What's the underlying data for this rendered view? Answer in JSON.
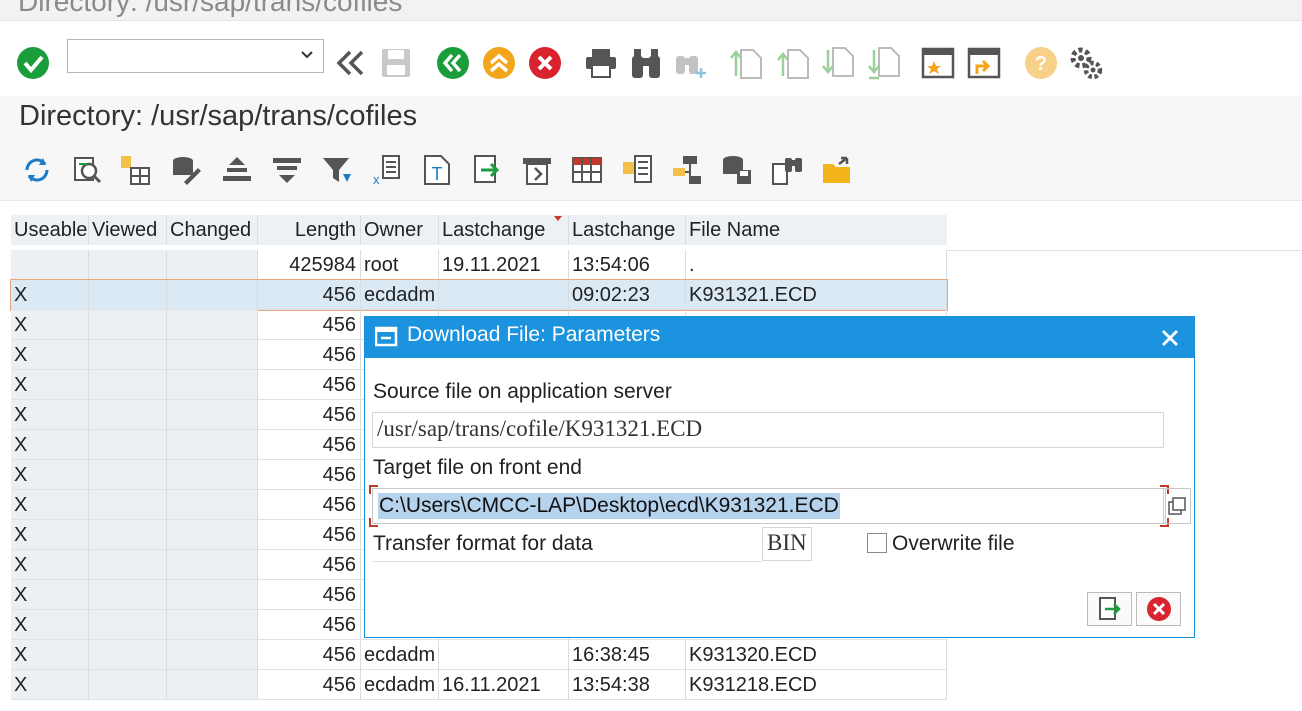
{
  "window": {
    "title": "Directory: /usr/sap/trans/cofiles"
  },
  "command_field": {
    "value": "",
    "placeholder": ""
  },
  "page": {
    "title": "Directory: /usr/sap/trans/cofiles"
  },
  "colors": {
    "accent": "#1c93de",
    "ok_green": "#1a9e3b",
    "cancel_red": "#d9232e",
    "warn_orange": "#f3a51c",
    "selection": "#dbe9f5",
    "header_bg": "#eef1f4"
  },
  "table": {
    "columns": [
      "Useable",
      "Viewed",
      "Changed",
      "Length",
      "Owner",
      "Lastchange",
      "Lastchange",
      "File Name"
    ],
    "rows": [
      {
        "useable": "",
        "viewed": "",
        "changed": "",
        "length": "425984",
        "owner": "root",
        "date": "19.11.2021",
        "time": "13:54:06",
        "file": "."
      },
      {
        "useable": "X",
        "viewed": "",
        "changed": "",
        "length": "456",
        "owner": "ecdadm",
        "date": "",
        "time": "09:02:23",
        "file": "K931321.ECD"
      },
      {
        "useable": "X",
        "viewed": "",
        "changed": "",
        "length": "456",
        "owner": "",
        "date": "",
        "time": "",
        "file": ""
      },
      {
        "useable": "X",
        "viewed": "",
        "changed": "",
        "length": "456",
        "owner": "",
        "date": "",
        "time": "",
        "file": ""
      },
      {
        "useable": "X",
        "viewed": "",
        "changed": "",
        "length": "456",
        "owner": "",
        "date": "",
        "time": "",
        "file": ""
      },
      {
        "useable": "X",
        "viewed": "",
        "changed": "",
        "length": "456",
        "owner": "",
        "date": "",
        "time": "",
        "file": ""
      },
      {
        "useable": "X",
        "viewed": "",
        "changed": "",
        "length": "456",
        "owner": "",
        "date": "",
        "time": "",
        "file": ""
      },
      {
        "useable": "X",
        "viewed": "",
        "changed": "",
        "length": "456",
        "owner": "",
        "date": "",
        "time": "",
        "file": ""
      },
      {
        "useable": "X",
        "viewed": "",
        "changed": "",
        "length": "456",
        "owner": "",
        "date": "",
        "time": "",
        "file": ""
      },
      {
        "useable": "X",
        "viewed": "",
        "changed": "",
        "length": "456",
        "owner": "",
        "date": "",
        "time": "",
        "file": ""
      },
      {
        "useable": "X",
        "viewed": "",
        "changed": "",
        "length": "456",
        "owner": "",
        "date": "",
        "time": "",
        "file": ""
      },
      {
        "useable": "X",
        "viewed": "",
        "changed": "",
        "length": "456",
        "owner": "",
        "date": "",
        "time": "",
        "file": ""
      },
      {
        "useable": "X",
        "viewed": "",
        "changed": "",
        "length": "456",
        "owner": "",
        "date": "",
        "time": "",
        "file": ""
      },
      {
        "useable": "X",
        "viewed": "",
        "changed": "",
        "length": "456",
        "owner": "ecdadm",
        "date": "",
        "time": "16:38:45",
        "file": "K931320.ECD"
      },
      {
        "useable": "X",
        "viewed": "",
        "changed": "",
        "length": "456",
        "owner": "ecdadm",
        "date": "16.11.2021",
        "time": "13:54:38",
        "file": "K931218.ECD"
      }
    ]
  },
  "dialog": {
    "title": "Download File: Parameters",
    "source_label": "Source file on application server",
    "source_value": "/usr/sap/trans/cofile/K931321.ECD",
    "target_label": "Target file on front end",
    "target_value": "C:\\Users\\CMCC-LAP\\Desktop\\ecd\\K931321.ECD",
    "format_label": "Transfer format for data",
    "format_value": "BIN",
    "overwrite_label": "Overwrite file",
    "overwrite_checked": false
  }
}
